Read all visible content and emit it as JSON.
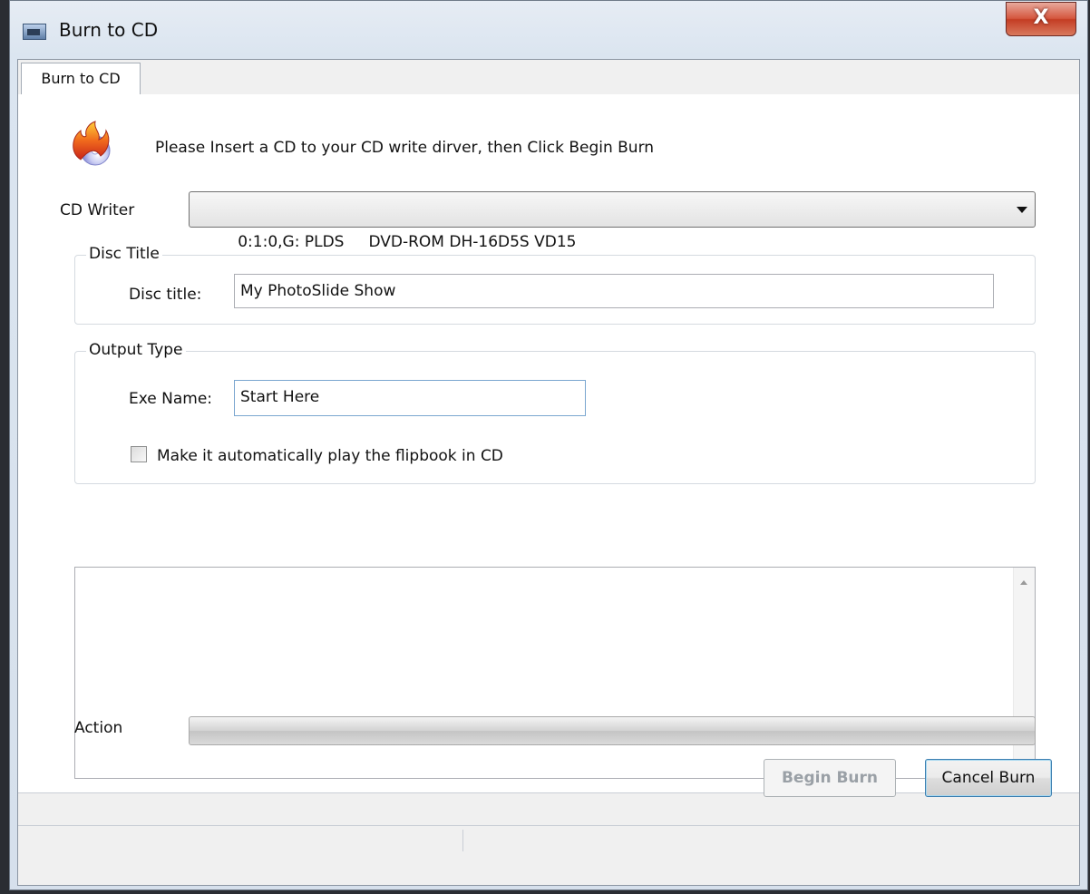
{
  "window": {
    "title": "Burn to CD",
    "close_symbol": "X"
  },
  "tabs": [
    {
      "label": "Burn to CD",
      "selected": true
    }
  ],
  "intro_text": "Please Insert a CD to your CD write dirver, then Click Begin Burn",
  "cd_writer": {
    "label": "CD Writer",
    "selected": "0:1:0,G: PLDS     DVD-ROM DH-16D5S VD15"
  },
  "disc_title_group": {
    "legend": "Disc Title",
    "field_label": "Disc title:",
    "value": "My PhotoSlide Show"
  },
  "output_type_group": {
    "legend": "Output Type",
    "exe_label": "Exe Name:",
    "exe_value": "Start Here",
    "autoplay_label": "Make it automatically play the flipbook in CD",
    "autoplay_checked": false
  },
  "action": {
    "label": "Action",
    "progress": 0
  },
  "buttons": {
    "begin_burn": "Begin Burn",
    "cancel_burn": "Cancel Burn"
  },
  "colors": {
    "accent": "#3c7fb1",
    "close_red": "#c43d24"
  },
  "icons": [
    "app-icon",
    "burn-flame-icon",
    "close-icon",
    "dropdown-arrow-icon",
    "scroll-up-icon",
    "scroll-down-icon"
  ]
}
